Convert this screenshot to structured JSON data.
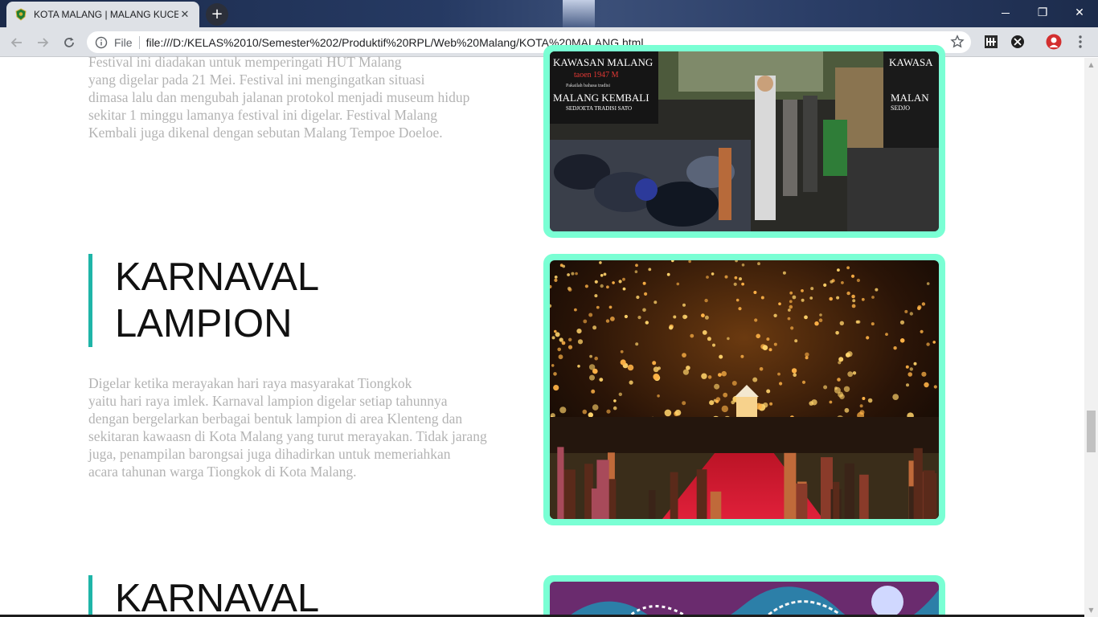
{
  "browser": {
    "tab_title": "KOTA MALANG | MALANG KUCE",
    "tab_close": "✕",
    "new_tab": "+",
    "omnibox_scheme": "File",
    "url": "file:///D:/KELAS%2010/Semester%202/Produktif%20RPL/Web%20Malang/KOTA%20MALANG.html",
    "window_restore": "❐",
    "window_close": "✕"
  },
  "sections": [
    {
      "paragraph_lines": [
        "Festival ini diadakan untuk memperingati HUT Malang",
        "yang digelar pada 21 Mei. Festival ini mengingatkan situasi",
        "dimasa lalu dan mengubah jalanan protokol menjadi museum hidup",
        "sekitar 1 minggu lamanya festival ini digelar. Festival Malang",
        "Kembali juga dikenal dengan sebutan Malang Tempoe Doeloe."
      ],
      "photo_signs": {
        "left_top": "KAWASAN MALANG",
        "left_sub": "taoen 1947 M",
        "left_small": "Pakailah bahasa tradisi",
        "left_main": "MALANG KEMBALI",
        "left_main_sub": "SEDJOETA TRADISI SATO",
        "right_top": "KAWASA",
        "right_main": "MALAN",
        "right_sub": "SEDJO"
      }
    },
    {
      "heading_lines": [
        "KARNAVAL",
        "LAMPION"
      ],
      "paragraph_lines": [
        "Digelar ketika merayakan hari raya masyarakat Tiongkok",
        "yaitu hari raya imlek. Karnaval lampion digelar setiap tahunnya",
        "dengan bergelarkan berbagai bentuk lampion di area Klenteng dan",
        "sekitaran kawaasn di Kota Malang yang turut merayakan. Tidak jarang",
        "juga, penampilan barongsai juga dihadirkan untuk memeriahkan",
        "acara tahunan warga Tiongkok di Kota Malang."
      ]
    },
    {
      "heading_lines": [
        "KARNAVAL"
      ]
    }
  ],
  "colors": {
    "accent_border": "#1fb5a8",
    "photo_frame": "#7affd4",
    "paragraph_text": "#b3b3b3",
    "heading_text": "#111111"
  },
  "icons": {
    "back": "arrow-left-icon",
    "forward": "arrow-right-icon",
    "reload": "reload-icon",
    "info": "info-icon",
    "bookmark": "star-icon",
    "menu": "kebab-menu-icon"
  }
}
